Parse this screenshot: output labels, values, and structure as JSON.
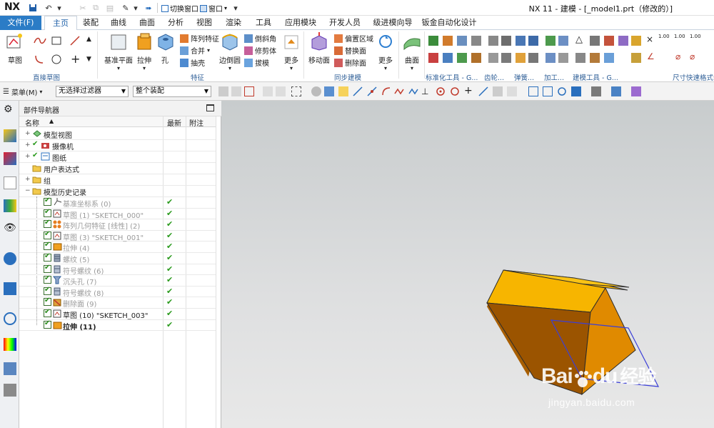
{
  "titlebar": {
    "logo": "NX",
    "switch_window": "切换窗口",
    "window": "窗口",
    "title": "NX 11 - 建模 - [_model1.prt（修改的）]"
  },
  "tabs": [
    "文件(F)",
    "主页",
    "装配",
    "曲线",
    "曲面",
    "分析",
    "视图",
    "渲染",
    "工具",
    "应用模块",
    "开发人员",
    "级进模向导",
    "钣金自动化设计"
  ],
  "ribbon": {
    "sketch": "草图",
    "direct_sketch": "直接草图",
    "datum_plane": "基准平面",
    "extrude": "拉伸",
    "hole": "孔",
    "pattern_feature": "阵列特征",
    "unite": "合并",
    "shell": "抽壳",
    "edge_blend": "边倒圆",
    "chamfer": "倒斜角",
    "trim_body": "修剪体",
    "draft": "拔模",
    "more": "更多",
    "feature_group": "特征",
    "move_face": "移动面",
    "offset_region": "偏置区域",
    "replace_face": "替换面",
    "delete_face": "删除面",
    "sync_group": "同步建模",
    "more2": "更多",
    "surface": "曲面",
    "std_tools": "标准化工具 - G...",
    "gear": "齿轮...",
    "spring": "弹簧...",
    "machining": "加工...",
    "modeling_tools": "建模工具 - G...",
    "dimension_quick": "尺寸快速格式化",
    "dim_100a": "1.00",
    "dim_100b": "1.00",
    "dim_100c": "1.00"
  },
  "toolbar2": {
    "menu": "菜单(M)",
    "filter": "无选择过滤器",
    "assembly": "整个装配"
  },
  "navigator": {
    "title": "部件导航器",
    "col_name": "名称",
    "col_latest": "最新",
    "col_note": "附注",
    "rows": [
      {
        "label": "模型视图",
        "gray": false
      },
      {
        "label": "摄像机",
        "gray": false
      },
      {
        "label": "图纸",
        "gray": false
      },
      {
        "label": "用户表达式",
        "gray": false
      },
      {
        "label": "组",
        "gray": false
      },
      {
        "label": "模型历史记录",
        "gray": false
      },
      {
        "label": "基准坐标系 (0)",
        "gray": true
      },
      {
        "label": "草图 (1) \"SKETCH_000\"",
        "gray": true
      },
      {
        "label": "阵列几何特征 [线性] (2)",
        "gray": true
      },
      {
        "label": "草图 (3) \"SKETCH_001\"",
        "gray": true
      },
      {
        "label": "拉伸 (4)",
        "gray": true
      },
      {
        "label": "螺纹 (5)",
        "gray": true
      },
      {
        "label": "符号螺纹 (6)",
        "gray": true
      },
      {
        "label": "沉头孔 (7)",
        "gray": true
      },
      {
        "label": "符号螺纹 (8)",
        "gray": true
      },
      {
        "label": "删除面 (9)",
        "gray": true
      },
      {
        "label": "草图 (10) \"SKETCH_003\"",
        "gray": false
      },
      {
        "label": "拉伸 (11)",
        "gray": false
      }
    ]
  },
  "watermark": {
    "brand_a": "Bai",
    "brand_b": "du",
    "brand_c": "经验",
    "url": "jingyan.baidu.com"
  },
  "colors": {
    "accent": "#2b7cc6",
    "box_top": "#f7b500",
    "box_front": "#a85e00",
    "box_side": "#e08a00",
    "sketch": "#3b3fd8"
  }
}
